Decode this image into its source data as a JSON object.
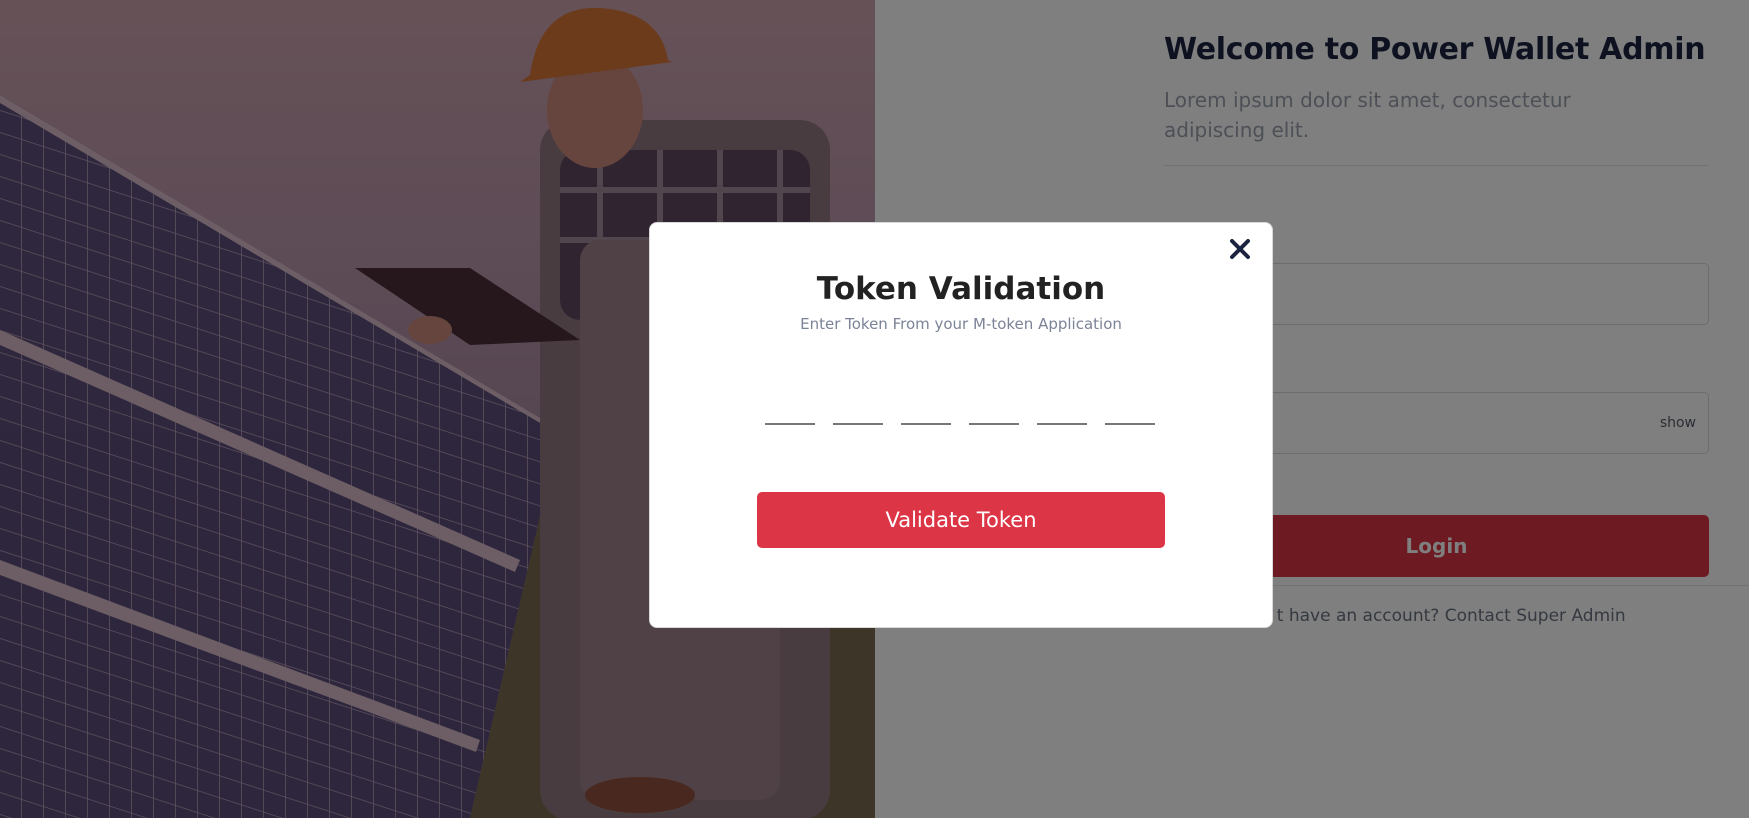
{
  "login": {
    "title": "Welcome to Power Wallet Admin",
    "subtitle": "Lorem ipsum dolor sit amet, consectetur adipiscing elit.",
    "password_toggle": "show",
    "login_button": "Login",
    "signup_text": "Don`t have an account? Contact Super Admin"
  },
  "modal": {
    "title": "Token Validation",
    "subtitle": "Enter Token From your M-token Application",
    "validate_button": "Validate Token",
    "close_icon": "close-icon"
  },
  "colors": {
    "accent": "#dc3545",
    "title": "#1c2340",
    "overlay": "rgba(0,0,0,0.5)"
  }
}
